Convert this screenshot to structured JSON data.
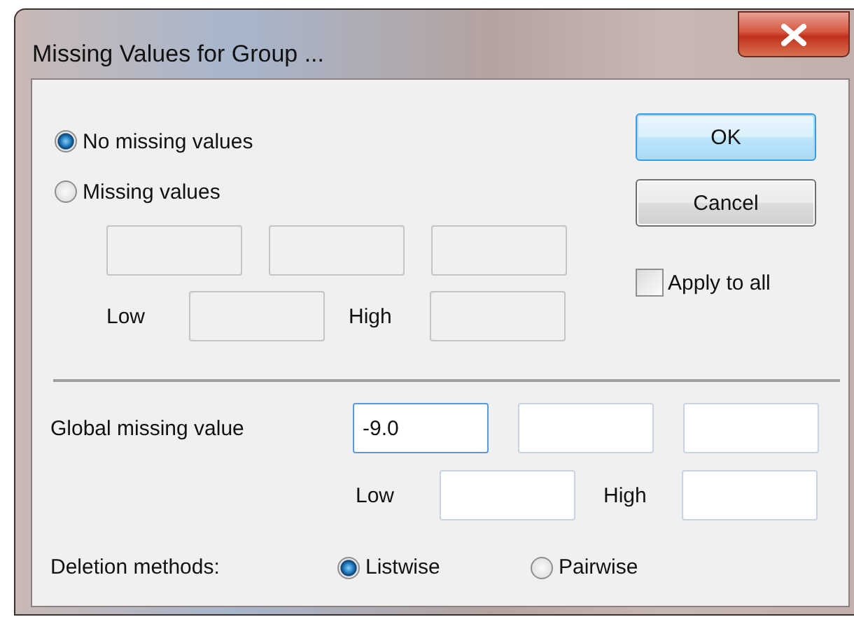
{
  "window": {
    "title": "Missing Values for Group ..."
  },
  "missing_options": [
    {
      "label": "No missing values",
      "selected": true
    },
    {
      "label": "Missing values",
      "selected": false
    }
  ],
  "missing_fields": {
    "disabled": true,
    "low_label": "Low",
    "high_label": "High"
  },
  "buttons": [
    {
      "label": "OK",
      "default": true
    },
    {
      "label": "Cancel",
      "default": false
    }
  ],
  "apply_to_all": {
    "label": "Apply to all",
    "checked": false
  },
  "global": {
    "label": "Global missing value",
    "value": "-9.0",
    "focused": true,
    "low_label": "Low",
    "high_label": "High"
  },
  "deletion": {
    "label": "Deletion methods:",
    "options": [
      {
        "label": "Listwise",
        "selected": true
      },
      {
        "label": "Pairwise",
        "selected": false
      }
    ]
  }
}
